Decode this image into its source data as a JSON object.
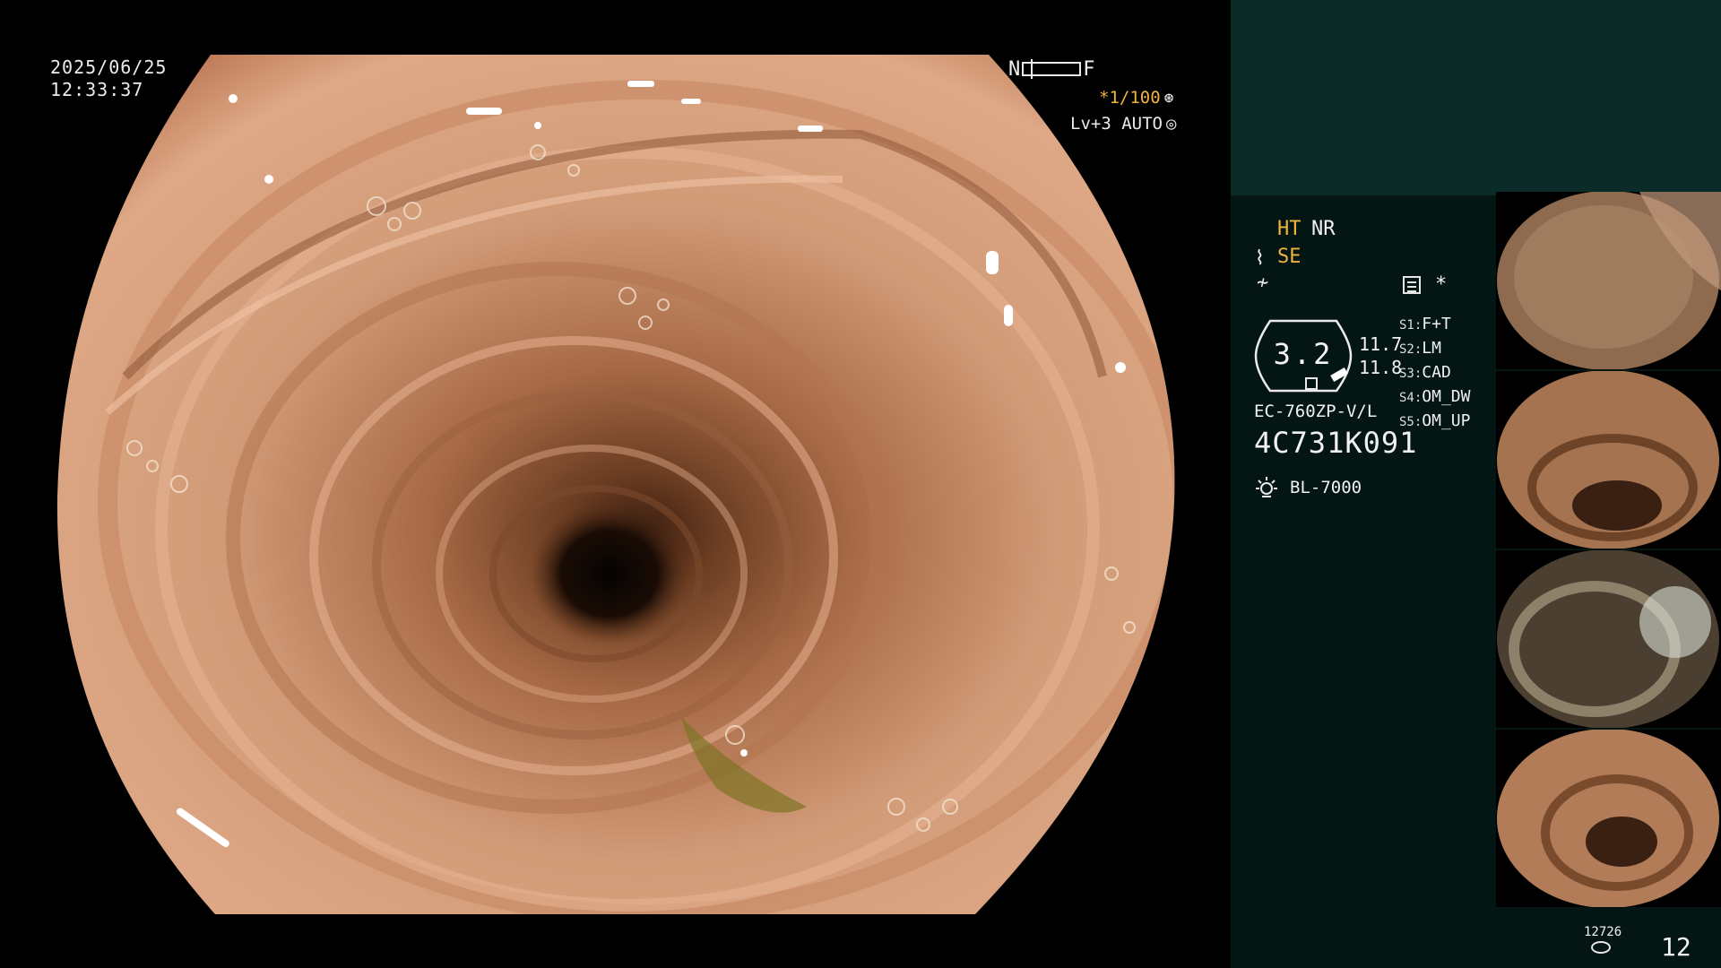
{
  "overlay": {
    "date": "2025/06/25",
    "time": "12:33:37",
    "nf_left": "N",
    "nf_right": "F",
    "shutter": "*1/100",
    "shutter_icon": "aperture-icon",
    "level": "Lv+3 AUTO",
    "level_icon": "iris-icon"
  },
  "panel": {
    "ht": "HT",
    "nr": "NR",
    "se": "SE",
    "star": "*",
    "gauge_value": "3.2",
    "gauge_reading_1": "11.7",
    "gauge_reading_2": "11.8",
    "scope_settings": [
      {
        "key": "S1:",
        "value": "F+T"
      },
      {
        "key": "S2:",
        "value": "LM"
      },
      {
        "key": "S3:",
        "value": "CAD"
      },
      {
        "key": "S4:",
        "value": "OM_DW"
      },
      {
        "key": "S5:",
        "value": "OM_UP"
      }
    ],
    "model": "EC-760ZP-V/L",
    "serial": "4C731K091",
    "light_source": "BL-7000",
    "image_counter_small": "12726",
    "image_counter": "12"
  },
  "colors": {
    "accent_orange": "#f0b43c",
    "panel_bg": "#041614",
    "panel_top_bg": "#0b2b29",
    "mucosa": "#c98a68"
  }
}
